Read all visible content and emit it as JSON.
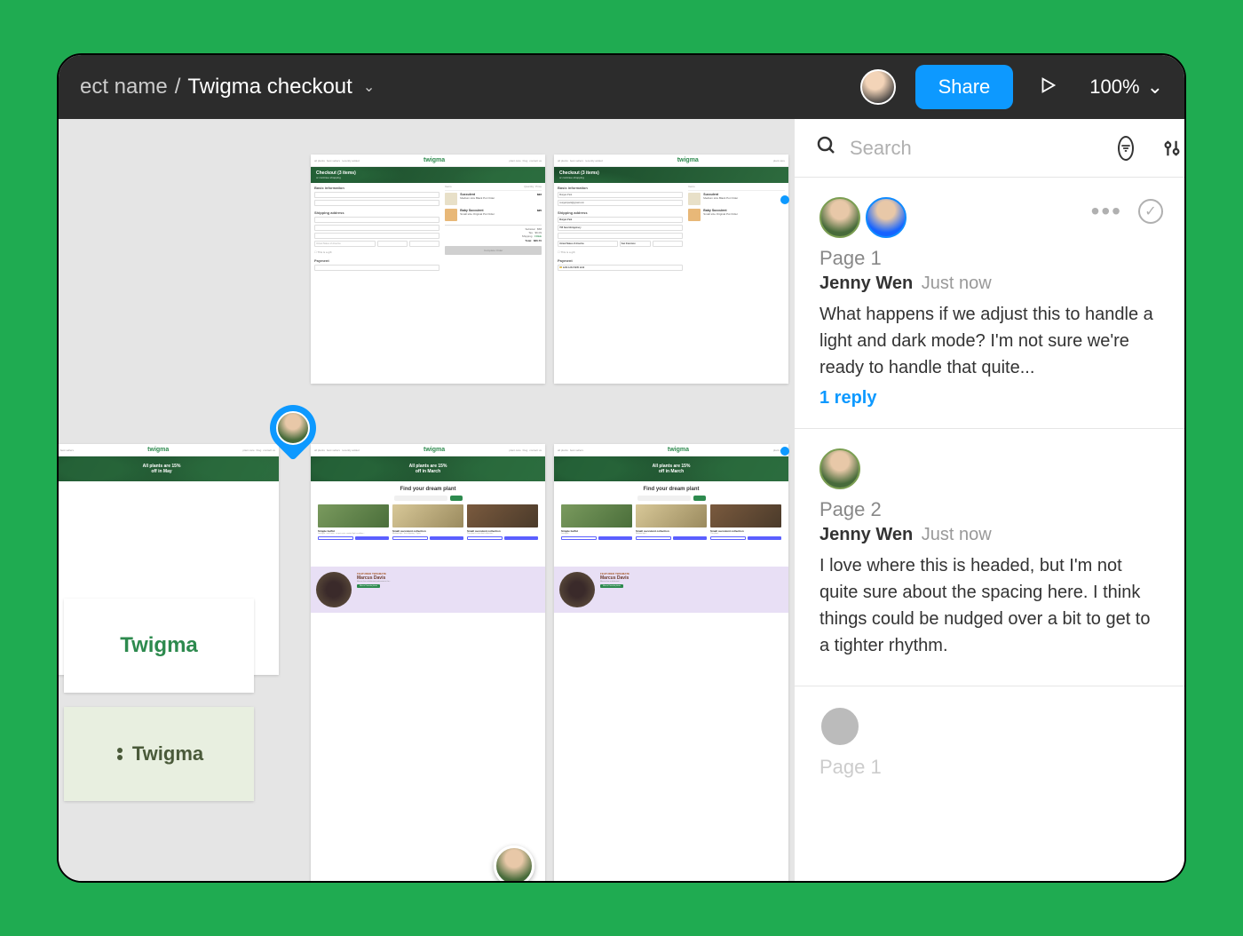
{
  "topbar": {
    "project_prefix": "ect name",
    "separator": "/",
    "file_name": "Twigma checkout",
    "share_label": "Share",
    "zoom_label": "100%"
  },
  "search": {
    "placeholder": "Search"
  },
  "comments": [
    {
      "page": "Page 1",
      "author": "Jenny Wen",
      "time": "Just now",
      "body": "What happens if we adjust this to handle a light and dark mode? I'm not sure we're ready to handle that quite...",
      "reply_link": "1 reply",
      "unread": true,
      "avatars": 2,
      "show_actions": true
    },
    {
      "page": "Page 2",
      "author": "Jenny Wen",
      "time": "Just now",
      "body": "I love where this is headed, but I'm not quite sure about the spacing here. I think things could be nudged over a bit to get to a tighter rhythm.",
      "reply_link": "",
      "unread": true,
      "avatars": 1,
      "show_actions": false
    },
    {
      "page": "Page 1",
      "author": "",
      "time": "",
      "body": "",
      "reply_link": "",
      "unread": false,
      "avatars": 1,
      "show_actions": false,
      "faded": true
    }
  ],
  "canvas_frames": {
    "brand": "twigma",
    "nav_left": [
      "all plants",
      "best sellers",
      "recently added"
    ],
    "nav_right": [
      "plant care",
      "blog",
      "contact us"
    ],
    "checkout": {
      "title": "Checkout (3 items)",
      "subtitle": "or continue shopping",
      "sections": {
        "basic": "Basic information",
        "shipping": "Shipping address",
        "payment": "Payment"
      },
      "cols": {
        "items": "Items",
        "qty": "Quantity",
        "price": "Price"
      },
      "items": [
        {
          "name": "Succulent",
          "meta": "Medium size\nBlack Pot\nOrder",
          "price": "$22"
        },
        {
          "name": "Baby Succulent",
          "meta": "Small size\nOriginal Pot\nOrder",
          "price": "$25"
        }
      ],
      "totals": {
        "subtotal_l": "Subtotal",
        "subtotal": "$58",
        "tax_l": "Tax",
        "tax": "$6.09",
        "ship_l": "Shipping",
        "ship": "FREE",
        "total_l": "Total",
        "total": "$66.70"
      },
      "complete": "Complete Order",
      "payment_masked": "1234 1234 5235 1214",
      "gift_label": "This is a gift",
      "form2": {
        "name": "Morgan Park",
        "email": "morgampark@gmail.com",
        "addr": "795 New Montgomery",
        "country": "United States of America",
        "city": "San Francisco"
      }
    },
    "home": {
      "banner_may": "All plants are 15%\noff in May",
      "banner_march": "All plants are 15%\noff in March",
      "find_title": "Find your dream plant",
      "card_titles": [
        "Simple buffet",
        "Small succulent collection",
        "Small succulent collection"
      ],
      "btn_white": "Save",
      "btn_purple": "In shopping cart",
      "btn_purple2": "Add to my bookmarks",
      "feature_tag": "FEATURED TWIGMATE",
      "feature_name": "Marcus Davis",
      "feature_btn": "Marcus' favorite plants"
    },
    "logo_text_1": "Twigma",
    "logo_text_2": "Twigma"
  }
}
